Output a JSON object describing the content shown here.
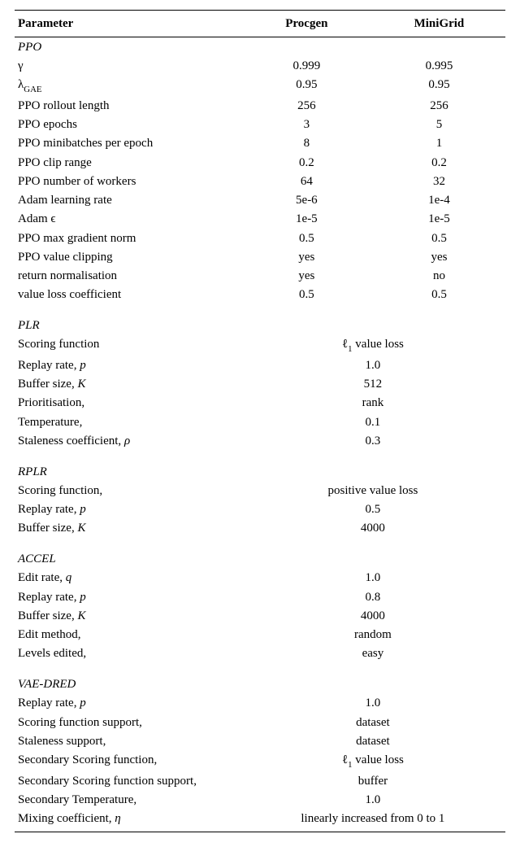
{
  "headers": {
    "param": "Parameter",
    "col1": "Procgen",
    "col2": "MiniGrid"
  },
  "sections": [
    {
      "title": "PPO",
      "rows": [
        {
          "param_html": "γ",
          "c1": "0.999",
          "c2": "0.995"
        },
        {
          "param_html": "λ<span class=\"sub\">GAE</span>",
          "c1": "0.95",
          "c2": "0.95"
        },
        {
          "param_html": "PPO rollout length",
          "c1": "256",
          "c2": "256"
        },
        {
          "param_html": "PPO epochs",
          "c1": "3",
          "c2": "5"
        },
        {
          "param_html": "PPO minibatches per epoch",
          "c1": "8",
          "c2": "1"
        },
        {
          "param_html": "PPO clip range",
          "c1": "0.2",
          "c2": "0.2"
        },
        {
          "param_html": "PPO number of workers",
          "c1": "64",
          "c2": "32"
        },
        {
          "param_html": "Adam learning rate",
          "c1": "5e-6",
          "c2": "1e-4"
        },
        {
          "param_html": "Adam ϵ",
          "c1": "1e-5",
          "c2": "1e-5"
        },
        {
          "param_html": "PPO max gradient norm",
          "c1": "0.5",
          "c2": "0.5"
        },
        {
          "param_html": "PPO value clipping",
          "c1": "yes",
          "c2": "yes"
        },
        {
          "param_html": "return normalisation",
          "c1": "yes",
          "c2": "no"
        },
        {
          "param_html": "value loss coefficient",
          "c1": "0.5",
          "c2": "0.5"
        }
      ]
    },
    {
      "title": "PLR",
      "rows": [
        {
          "param_html": "Scoring function",
          "span_html": "ℓ<span class=\"sub\">1</span> value loss"
        },
        {
          "param_html": "Replay rate, <i>p</i>",
          "span": "1.0"
        },
        {
          "param_html": "Buffer size, <i>K</i>",
          "span": "512"
        },
        {
          "param_html": "Prioritisation,",
          "span": "rank"
        },
        {
          "param_html": "Temperature,",
          "span": "0.1"
        },
        {
          "param_html": "Staleness coefficient, <i>ρ</i>",
          "span": "0.3"
        }
      ]
    },
    {
      "title": "RPLR",
      "rows": [
        {
          "param_html": "Scoring function,",
          "span": "positive value loss"
        },
        {
          "param_html": "Replay rate, <i>p</i>",
          "span": "0.5"
        },
        {
          "param_html": "Buffer size, <i>K</i>",
          "span": "4000"
        }
      ]
    },
    {
      "title": "ACCEL",
      "rows": [
        {
          "param_html": "Edit rate, <i>q</i>",
          "span": "1.0"
        },
        {
          "param_html": "Replay rate, <i>p</i>",
          "span": "0.8"
        },
        {
          "param_html": "Buffer size, <i>K</i>",
          "span": "4000"
        },
        {
          "param_html": "Edit method,",
          "span": "random"
        },
        {
          "param_html": "Levels edited,",
          "span": "easy"
        }
      ]
    },
    {
      "title": "VAE-DRED",
      "rows": [
        {
          "param_html": "Replay rate, <i>p</i>",
          "span": "1.0"
        },
        {
          "param_html": "Scoring function support,",
          "span": "dataset"
        },
        {
          "param_html": "Staleness support,",
          "span": "dataset"
        },
        {
          "param_html": "Secondary Scoring function,",
          "span_html": "ℓ<span class=\"sub\">1</span> value loss"
        },
        {
          "param_html": "Secondary Scoring function support,",
          "span": "buffer"
        },
        {
          "param_html": "Secondary Temperature,",
          "span": "1.0"
        },
        {
          "param_html": "Mixing coefficient, <i>η</i>",
          "span": "linearly increased from 0 to 1"
        }
      ]
    }
  ],
  "chart_data": {
    "type": "table",
    "title": "Hyperparameters for Procgen and MiniGrid experiments",
    "columns": [
      "Parameter",
      "Procgen",
      "MiniGrid"
    ],
    "groups": [
      {
        "name": "PPO",
        "rows": [
          [
            "gamma",
            "0.999",
            "0.995"
          ],
          [
            "lambda_GAE",
            "0.95",
            "0.95"
          ],
          [
            "PPO rollout length",
            "256",
            "256"
          ],
          [
            "PPO epochs",
            "3",
            "5"
          ],
          [
            "PPO minibatches per epoch",
            "8",
            "1"
          ],
          [
            "PPO clip range",
            "0.2",
            "0.2"
          ],
          [
            "PPO number of workers",
            "64",
            "32"
          ],
          [
            "Adam learning rate",
            "5e-6",
            "1e-4"
          ],
          [
            "Adam epsilon",
            "1e-5",
            "1e-5"
          ],
          [
            "PPO max gradient norm",
            "0.5",
            "0.5"
          ],
          [
            "PPO value clipping",
            "yes",
            "yes"
          ],
          [
            "return normalisation",
            "yes",
            "no"
          ],
          [
            "value loss coefficient",
            "0.5",
            "0.5"
          ]
        ]
      },
      {
        "name": "PLR",
        "rows": [
          [
            "Scoring function",
            "l1 value loss",
            "l1 value loss"
          ],
          [
            "Replay rate p",
            "1.0",
            "1.0"
          ],
          [
            "Buffer size K",
            "512",
            "512"
          ],
          [
            "Prioritisation",
            "rank",
            "rank"
          ],
          [
            "Temperature",
            "0.1",
            "0.1"
          ],
          [
            "Staleness coefficient rho",
            "0.3",
            "0.3"
          ]
        ]
      },
      {
        "name": "RPLR",
        "rows": [
          [
            "Scoring function",
            "positive value loss",
            "positive value loss"
          ],
          [
            "Replay rate p",
            "0.5",
            "0.5"
          ],
          [
            "Buffer size K",
            "4000",
            "4000"
          ]
        ]
      },
      {
        "name": "ACCEL",
        "rows": [
          [
            "Edit rate q",
            "1.0",
            "1.0"
          ],
          [
            "Replay rate p",
            "0.8",
            "0.8"
          ],
          [
            "Buffer size K",
            "4000",
            "4000"
          ],
          [
            "Edit method",
            "random",
            "random"
          ],
          [
            "Levels edited",
            "easy",
            "easy"
          ]
        ]
      },
      {
        "name": "VAE-DRED",
        "rows": [
          [
            "Replay rate p",
            "1.0",
            "1.0"
          ],
          [
            "Scoring function support",
            "dataset",
            "dataset"
          ],
          [
            "Staleness support",
            "dataset",
            "dataset"
          ],
          [
            "Secondary Scoring function",
            "l1 value loss",
            "l1 value loss"
          ],
          [
            "Secondary Scoring function support",
            "buffer",
            "buffer"
          ],
          [
            "Secondary Temperature",
            "1.0",
            "1.0"
          ],
          [
            "Mixing coefficient eta",
            "linearly increased from 0 to 1",
            "linearly increased from 0 to 1"
          ]
        ]
      }
    ]
  }
}
